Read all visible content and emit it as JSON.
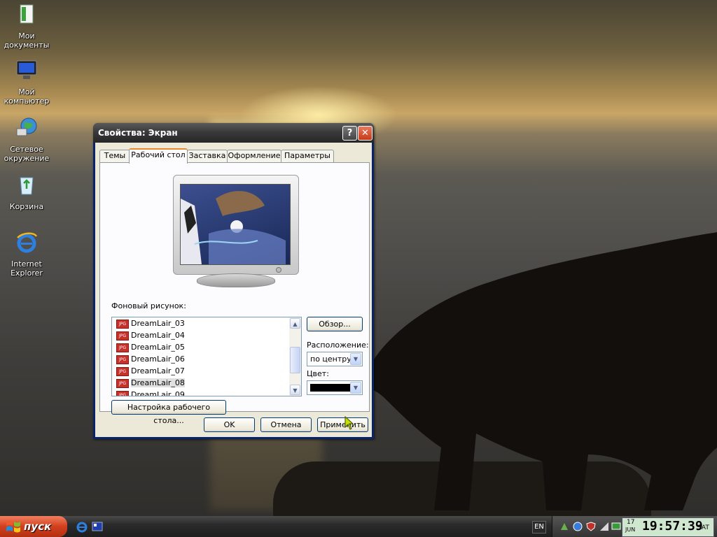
{
  "desktop": {
    "icons": [
      {
        "name": "my-documents",
        "label_lines": [
          "Мои",
          "документы"
        ]
      },
      {
        "name": "my-computer",
        "label_lines": [
          "Мой",
          "компьютер"
        ]
      },
      {
        "name": "network",
        "label_lines": [
          "Сетевое",
          "окружение"
        ]
      },
      {
        "name": "recycle-bin",
        "label_lines": [
          "Корзина"
        ]
      },
      {
        "name": "ie",
        "label_lines": [
          "Internet",
          "Explorer"
        ]
      }
    ]
  },
  "dialog": {
    "title": "Свойства: Экран",
    "help_label": "?",
    "close_label": "✕",
    "tabs": [
      "Темы",
      "Рабочий стол",
      "Заставка",
      "Оформление",
      "Параметры"
    ],
    "active_tab": 1,
    "background_label": "Фоновый рисунок:",
    "files": [
      "DreamLair_03",
      "DreamLair_04",
      "DreamLair_05",
      "DreamLair_06",
      "DreamLair_07",
      "DreamLair_08",
      "DreamLair_09"
    ],
    "file_badge": "JPG",
    "selected_file": "DreamLair_08",
    "browse_label": "Обзор...",
    "position_label": "Расположение:",
    "position_value": "по центру",
    "color_label": "Цвет:",
    "color_value": "#000000",
    "customize_label": "Настройка рабочего стола...",
    "ok_label": "OK",
    "cancel_label": "Отмена",
    "apply_label": "Применить"
  },
  "taskbar": {
    "start_label": "пуск",
    "lang": "EN",
    "date_day": "17",
    "date_month": "JUN",
    "time": "19:57:39",
    "weekday": "SAT"
  }
}
